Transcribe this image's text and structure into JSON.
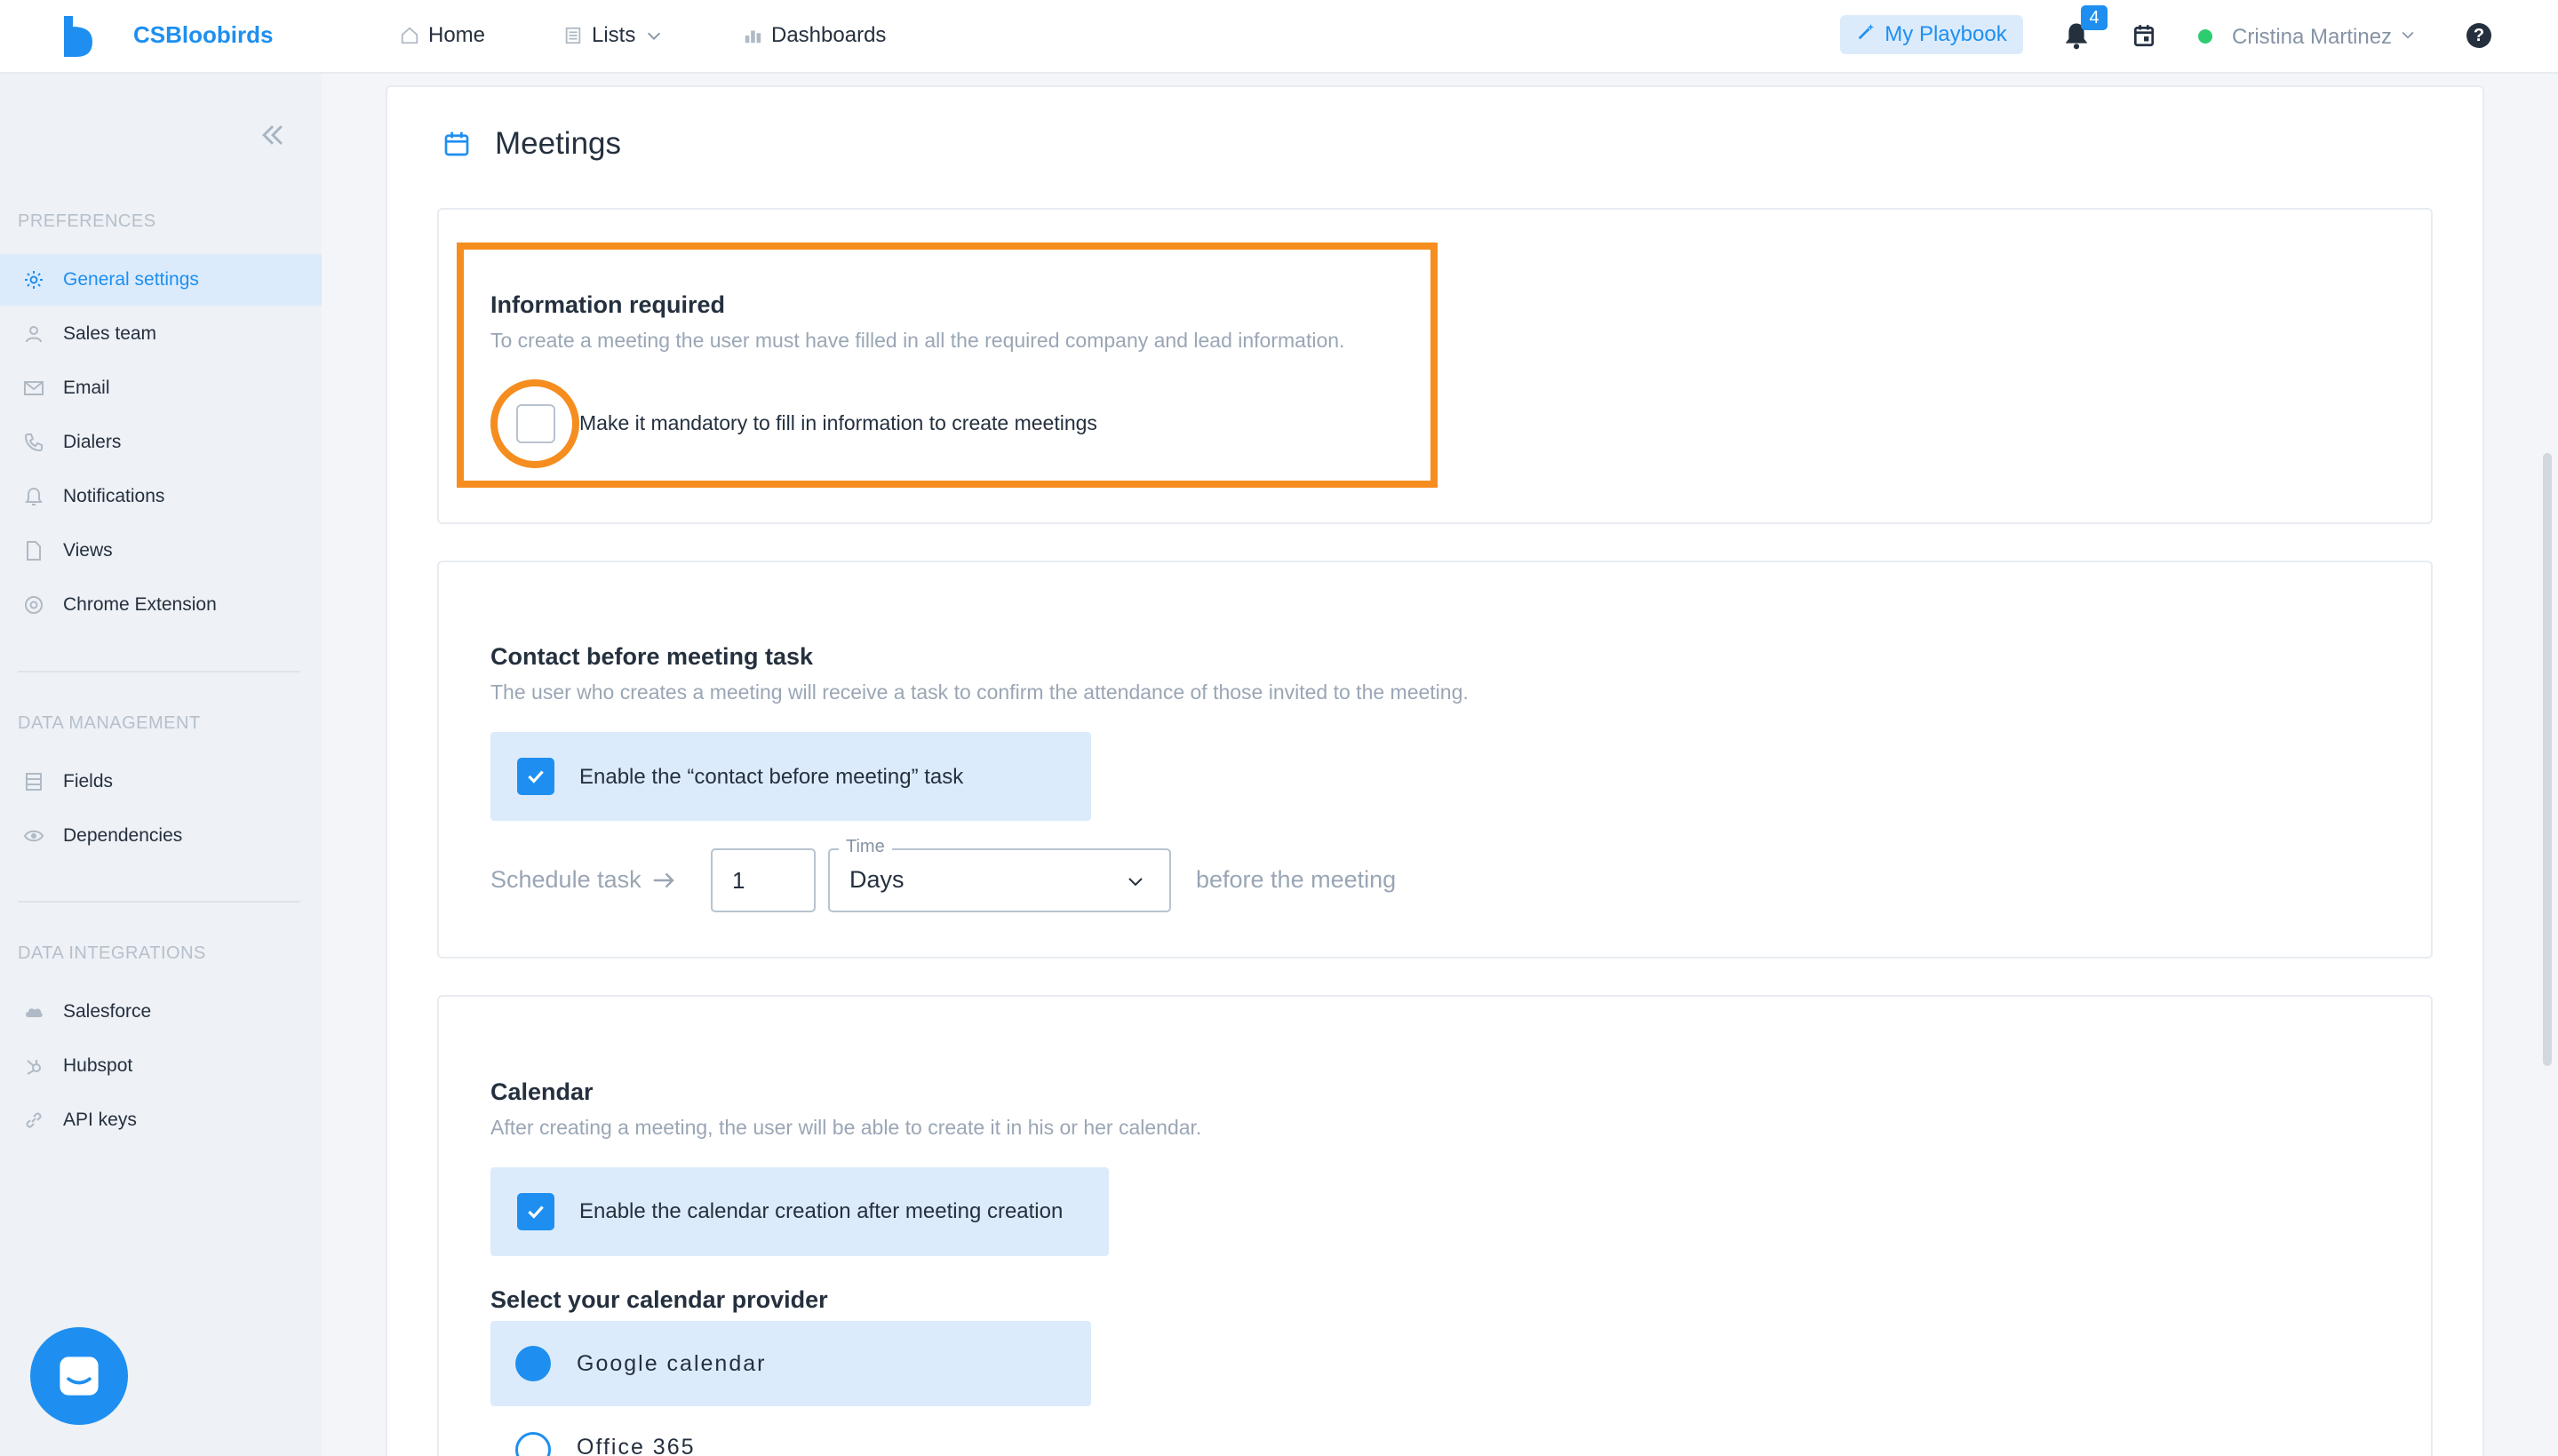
{
  "app": {
    "brand": "CSBloobirds",
    "brand_color": "#1e8ff0"
  },
  "topnav": {
    "items": [
      {
        "label": "Home",
        "icon": "home-icon"
      },
      {
        "label": "Lists",
        "icon": "list-icon"
      },
      {
        "label": "Dashboards",
        "icon": "bar-chart-icon"
      }
    ],
    "playbook_label": "My Playbook",
    "notification_count": "4",
    "user_name": "Cristina Martinez",
    "help_label": "?"
  },
  "sidebar": {
    "sections": [
      {
        "title": "PREFERENCES",
        "items": [
          {
            "label": "General settings",
            "icon": "gear-icon",
            "active": true
          },
          {
            "label": "Sales team",
            "icon": "user-icon"
          },
          {
            "label": "Email",
            "icon": "mail-icon"
          },
          {
            "label": "Dialers",
            "icon": "phone-icon"
          },
          {
            "label": "Notifications",
            "icon": "bell-icon"
          },
          {
            "label": "Views",
            "icon": "file-icon"
          },
          {
            "label": "Chrome Extension",
            "icon": "chrome-icon"
          }
        ]
      },
      {
        "title": "DATA MANAGEMENT",
        "items": [
          {
            "label": "Fields",
            "icon": "fields-icon"
          },
          {
            "label": "Dependencies",
            "icon": "eye-icon"
          }
        ]
      },
      {
        "title": "DATA INTEGRATIONS",
        "items": [
          {
            "label": "Salesforce",
            "icon": "salesforce-icon"
          },
          {
            "label": "Hubspot",
            "icon": "hubspot-icon"
          },
          {
            "label": "API keys",
            "icon": "link-icon"
          }
        ]
      }
    ]
  },
  "page": {
    "title": "Meetings",
    "icon": "calendar-icon"
  },
  "info_required": {
    "title": "Information required",
    "description": "To create a meeting the user must have filled in all the required company and lead information.",
    "checkbox_label": "Make it mandatory to fill in information to create meetings",
    "checked": false
  },
  "contact_task": {
    "title": "Contact before meeting task",
    "description": "The user who creates a meeting will receive a task to confirm the attendance of those invited to the meeting.",
    "checkbox_label": "Enable the “contact before meeting” task",
    "checked": true,
    "schedule_label": "Schedule task",
    "amount": "1",
    "time_legend": "Time",
    "time_value": "Days",
    "after_label": "before the meeting"
  },
  "calendar": {
    "title": "Calendar",
    "description": "After creating a meeting, the user will be able to create it in his or her calendar.",
    "checkbox_label": "Enable the calendar creation after meeting creation",
    "checked": true,
    "provider_title": "Select your calendar provider",
    "providers": [
      {
        "label": "Google calendar",
        "selected": true
      },
      {
        "label": "Office 365",
        "selected": false
      }
    ]
  },
  "highlight_color": "#f58d1f"
}
